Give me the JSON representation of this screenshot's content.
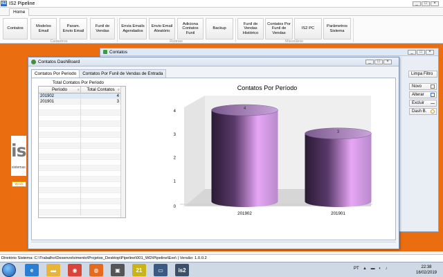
{
  "app": {
    "title": "IS2 Pipeline",
    "icon_text": "IS2",
    "tab_home": "Home",
    "window_buttons": [
      "_",
      "□",
      "×"
    ]
  },
  "ribbon": {
    "buttons": [
      {
        "label": "Contatos"
      },
      {
        "label": "Modelos\nEmail"
      },
      {
        "label": "Param.\nEnvio Email"
      },
      {
        "label": "Funil de\nVendas"
      },
      {
        "label": "Envia Emails\nAgendados"
      },
      {
        "label": "Envio Email\nAleatório"
      },
      {
        "label": "Adiciona\nContatos\nFunil"
      },
      {
        "label": "Backup"
      },
      {
        "label": "Funil de\nVendas\nHistórico"
      },
      {
        "label": "Contatos Por\nFunil de\nVendas"
      },
      {
        "label": "IS2 PC"
      },
      {
        "label": "Parâmetros\nSistema"
      }
    ],
    "groups": [
      "Cadastros",
      "Rotinas",
      "Miscelânio"
    ]
  },
  "desktop": {
    "logo_text": "is2",
    "logo_sub": "sistemas",
    "logo_small": "Winds"
  },
  "contatos_window": {
    "title": "Contatos",
    "buttons": [
      "Limpa Filtro",
      "Novo",
      "Alterar",
      "Excluir",
      "Dash B."
    ],
    "window_buttons": [
      "_",
      "□",
      "×"
    ]
  },
  "dashboard": {
    "title": "Contatos DashBoard",
    "window_buttons": [
      "_",
      "□",
      "×"
    ],
    "tabs": [
      "Contatos Por Periodo",
      "Contatos Por Funil de Vendas de Entrada"
    ],
    "grid": {
      "caption": "Total Contatos Por Periodo",
      "columns": [
        "Período",
        "Total Contatos"
      ],
      "rows": [
        {
          "periodo": "201902",
          "total": "4"
        },
        {
          "periodo": "201901",
          "total": "3"
        }
      ]
    }
  },
  "chart_data": {
    "type": "bar",
    "title": "Contatos Por Período",
    "categories": [
      "201902",
      "201901"
    ],
    "values": [
      4,
      3
    ],
    "ylim": [
      0,
      4
    ],
    "yticks": [
      0,
      1,
      2,
      3,
      4
    ],
    "xlabel": "",
    "ylabel": "",
    "style": "3d-cylinder",
    "colors": {
      "dark": "#2a1a33",
      "light": "#e7a6f5",
      "mid": "#b88acb"
    },
    "grid": false,
    "legend": "none"
  },
  "status": {
    "text": "Diretório Sistema: C:\\Trabalho\\Desenvolvimento\\Projetos_Desktop\\Pipeline\\001_WD\\Pipeline\\Exe\\ | Versão: 1.0.0.2"
  },
  "taskbar": {
    "apps": [
      {
        "icon": "ie-icon",
        "color": "#2a7fd4",
        "glyph": "e"
      },
      {
        "icon": "folder-icon",
        "color": "#e8b53a",
        "glyph": "▬"
      },
      {
        "icon": "chrome-icon",
        "color": "#d9443a",
        "glyph": "◉"
      },
      {
        "icon": "firefox-icon",
        "color": "#e66a1e",
        "glyph": "◍"
      },
      {
        "icon": "windev-icon",
        "color": "#555555",
        "glyph": "▣"
      },
      {
        "icon": "app21-icon",
        "color": "#c8b31a",
        "glyph": "21"
      },
      {
        "icon": "monitor-icon",
        "color": "#3a5a82",
        "glyph": "▭"
      },
      {
        "icon": "is2-icon",
        "color": "#3d4f66",
        "glyph": "is2"
      }
    ],
    "lang": "PT",
    "time": "22:38",
    "date": "16/02/2019"
  }
}
